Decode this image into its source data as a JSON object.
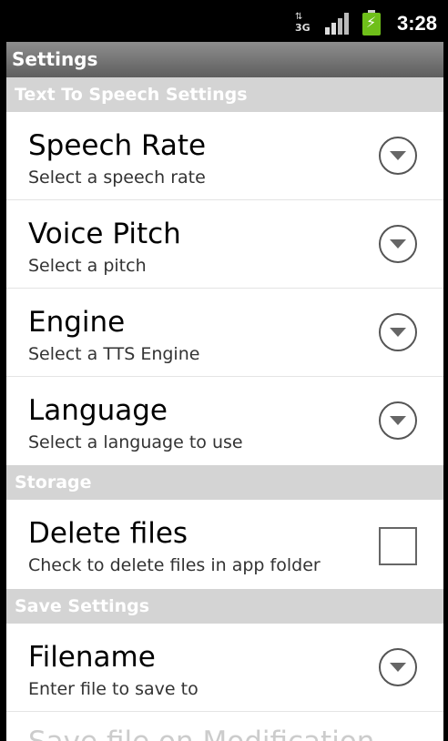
{
  "status_bar": {
    "network_label": "3G",
    "network_arrows": "⇅",
    "time": "3:28"
  },
  "app": {
    "title": "Settings"
  },
  "sections": [
    {
      "header": "Text To Speech Settings",
      "items": [
        {
          "title": "Speech Rate",
          "summary": "Select a speech rate",
          "widget": "dropdown-icon"
        },
        {
          "title": "Voice Pitch",
          "summary": "Select a pitch",
          "widget": "dropdown-icon"
        },
        {
          "title": "Engine",
          "summary": "Select a TTS Engine",
          "widget": "dropdown-icon"
        },
        {
          "title": "Language",
          "summary": "Select a language to use",
          "widget": "dropdown-icon"
        }
      ]
    },
    {
      "header": "Storage",
      "items": [
        {
          "title": "Delete files",
          "summary": "Check to delete files in app folder",
          "widget": "checkbox",
          "checked": false
        }
      ]
    },
    {
      "header": "Save Settings",
      "items": [
        {
          "title": "Filename",
          "summary": "Enter file to save to",
          "widget": "dropdown-icon"
        }
      ]
    }
  ],
  "partial_item": {
    "title": "Save file on Modification"
  },
  "colors": {
    "title_bar": "#6e6e6e",
    "category_bg": "#d4d4d4",
    "battery": "#6fbf1a"
  }
}
